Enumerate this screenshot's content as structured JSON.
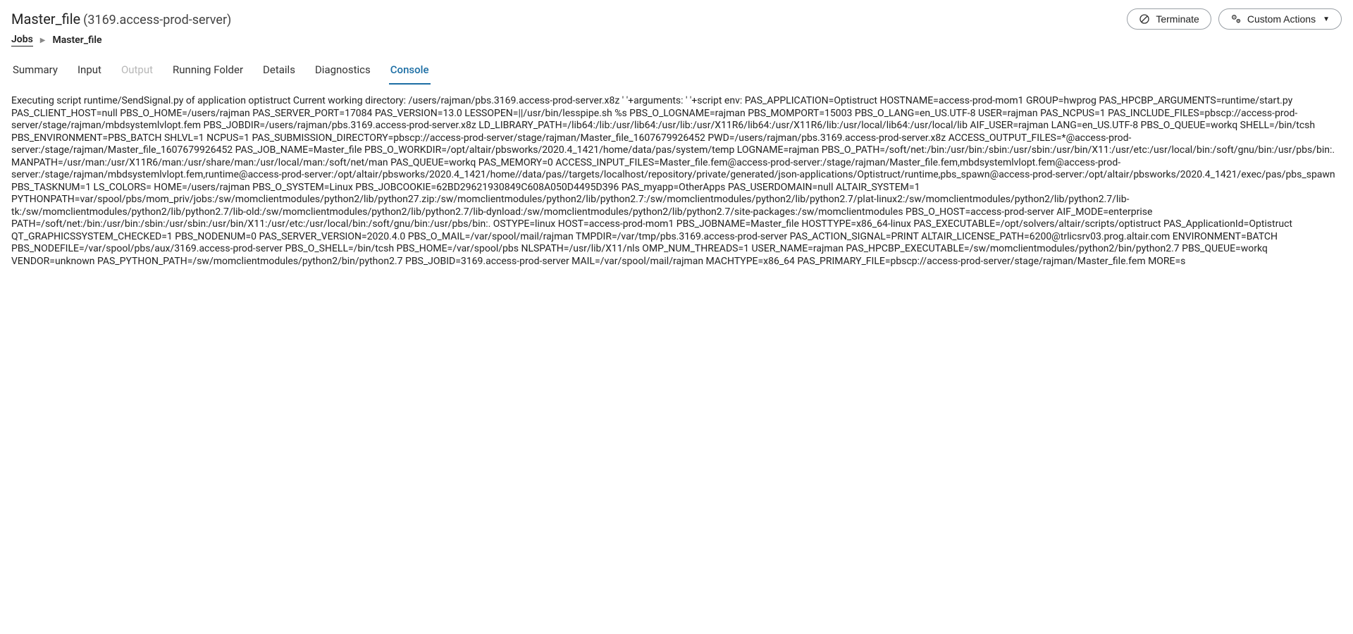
{
  "header": {
    "title_main": "Master_file",
    "title_sub": "(3169.access-prod-server)"
  },
  "actions": {
    "terminate_label": "Terminate",
    "custom_actions_label": "Custom Actions"
  },
  "breadcrumb": {
    "root": "Jobs",
    "current": "Master_file"
  },
  "tabs": [
    {
      "id": "summary",
      "label": "Summary",
      "active": false,
      "disabled": false
    },
    {
      "id": "input",
      "label": "Input",
      "active": false,
      "disabled": false
    },
    {
      "id": "output",
      "label": "Output",
      "active": false,
      "disabled": true
    },
    {
      "id": "running-folder",
      "label": "Running Folder",
      "active": false,
      "disabled": false
    },
    {
      "id": "details",
      "label": "Details",
      "active": false,
      "disabled": false
    },
    {
      "id": "diagnostics",
      "label": "Diagnostics",
      "active": false,
      "disabled": false
    },
    {
      "id": "console",
      "label": "Console",
      "active": true,
      "disabled": false
    }
  ],
  "console_output": "Executing script runtime/SendSignal.py of application optistruct Current working directory: /users/rajman/pbs.3169.access-prod-server.x8z ' '+arguments: ' '+script env: PAS_APPLICATION=Optistruct HOSTNAME=access-prod-mom1 GROUP=hwprog PAS_HPCBP_ARGUMENTS=runtime/start.py PAS_CLIENT_HOST=null PBS_O_HOME=/users/rajman PAS_SERVER_PORT=17084 PAS_VERSION=13.0 LESSOPEN=||/usr/bin/lesspipe.sh %s PBS_O_LOGNAME=rajman PBS_MOMPORT=15003 PBS_O_LANG=en_US.UTF-8 USER=rajman PAS_NCPUS=1 PAS_INCLUDE_FILES=pbscp://access-prod-server/stage/rajman/mbdsystemlvlopt.fem PBS_JOBDIR=/users/rajman/pbs.3169.access-prod-server.x8z LD_LIBRARY_PATH=/lib64:/lib:/usr/lib64:/usr/lib:/usr/X11R6/lib64:/usr/X11R6/lib:/usr/local/lib64:/usr/local/lib AIF_USER=rajman LANG=en_US.UTF-8 PBS_O_QUEUE=workq SHELL=/bin/tcsh PBS_ENVIRONMENT=PBS_BATCH SHLVL=1 NCPUS=1 PAS_SUBMISSION_DIRECTORY=pbscp://access-prod-server/stage/rajman/Master_file_1607679926452 PWD=/users/rajman/pbs.3169.access-prod-server.x8z ACCESS_OUTPUT_FILES=*@access-prod-server:/stage/rajman/Master_file_1607679926452 PAS_JOB_NAME=Master_file PBS_O_WORKDIR=/opt/altair/pbsworks/2020.4_1421/home/data/pas/system/temp LOGNAME=rajman PBS_O_PATH=/soft/net:/bin:/usr/bin:/sbin:/usr/sbin:/usr/bin/X11:/usr/etc:/usr/local/bin:/soft/gnu/bin:/usr/pbs/bin:. MANPATH=/usr/man:/usr/X11R6/man:/usr/share/man:/usr/local/man:/soft/net/man PAS_QUEUE=workq PAS_MEMORY=0 ACCESS_INPUT_FILES=Master_file.fem@access-prod-server:/stage/rajman/Master_file.fem,mbdsystemlvlopt.fem@access-prod-server:/stage/rajman/mbdsystemlvlopt.fem,runtime@access-prod-server:/opt/altair/pbsworks/2020.4_1421/home//data/pas//targets/localhost/repository/private/generated/json-applications/Optistruct/runtime,pbs_spawn@access-prod-server:/opt/altair/pbsworks/2020.4_1421/exec/pas/pbs_spawn PBS_TASKNUM=1 LS_COLORS= HOME=/users/rajman PBS_O_SYSTEM=Linux PBS_JOBCOOKIE=62BD29621930849C608A050D4495D396 PAS_myapp=OtherApps PAS_USERDOMAIN=null ALTAIR_SYSTEM=1 PYTHONPATH=var/spool/pbs/mom_priv/jobs:/sw/momclientmodules/python2/lib/python27.zip:/sw/momclientmodules/python2/lib/python2.7:/sw/momclientmodules/python2/lib/python2.7/plat-linux2:/sw/momclientmodules/python2/lib/python2.7/lib-tk:/sw/momclientmodules/python2/lib/python2.7/lib-old:/sw/momclientmodules/python2/lib/python2.7/lib-dynload:/sw/momclientmodules/python2/lib/python2.7/site-packages:/sw/momclientmodules PBS_O_HOST=access-prod-server AIF_MODE=enterprise PATH=/soft/net:/bin:/usr/bin:/sbin:/usr/sbin:/usr/bin/X11:/usr/etc:/usr/local/bin:/soft/gnu/bin:/usr/pbs/bin:. OSTYPE=linux HOST=access-prod-mom1 PBS_JOBNAME=Master_file HOSTTYPE=x86_64-linux PAS_EXECUTABLE=/opt/solvers/altair/scripts/optistruct PAS_ApplicationId=Optistruct QT_GRAPHICSSYSTEM_CHECKED=1 PBS_NODENUM=0 PAS_SERVER_VERSION=2020.4.0 PBS_O_MAIL=/var/spool/mail/rajman TMPDIR=/var/tmp/pbs.3169.access-prod-server PAS_ACTION_SIGNAL=PRINT ALTAIR_LICENSE_PATH=6200@trlicsrv03.prog.altair.com ENVIRONMENT=BATCH PBS_NODEFILE=/var/spool/pbs/aux/3169.access-prod-server PBS_O_SHELL=/bin/tcsh PBS_HOME=/var/spool/pbs NLSPATH=/usr/lib/X11/nls OMP_NUM_THREADS=1 USER_NAME=rajman PAS_HPCBP_EXECUTABLE=/sw/momclientmodules/python2/bin/python2.7 PBS_QUEUE=workq VENDOR=unknown PAS_PYTHON_PATH=/sw/momclientmodules/python2/bin/python2.7 PBS_JOBID=3169.access-prod-server MAIL=/var/spool/mail/rajman MACHTYPE=x86_64 PAS_PRIMARY_FILE=pbscp://access-prod-server/stage/rajman/Master_file.fem MORE=s"
}
